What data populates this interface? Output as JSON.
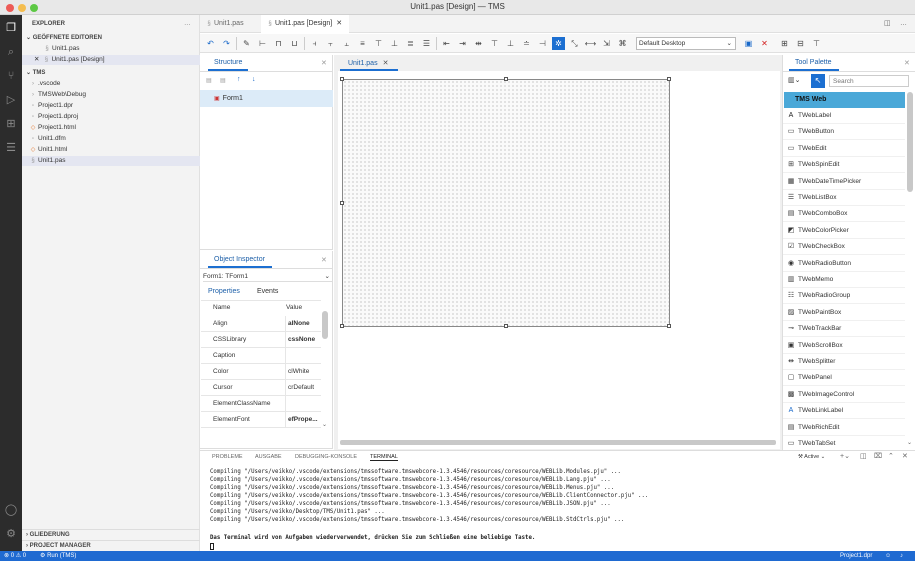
{
  "window": {
    "title": "Unit1.pas [Design] — TMS"
  },
  "sidebar": {
    "header": "EXPLORER",
    "open_editors_label": "GEÖFFNETE EDITOREN",
    "open_editors": [
      "Unit1.pas",
      "Unit1.pas [Design]"
    ],
    "project_label": "TMS",
    "files": [
      ".vscode",
      "TMSWeb\\Debug",
      "Project1.dpr",
      "Project1.dproj",
      "Project1.html",
      "Unit1.dfm",
      "Unit1.html",
      "Unit1.pas"
    ],
    "outline_label": "GLIEDERUNG",
    "project_manager_label": "PROJECT MANAGER"
  },
  "editor_tabs": [
    "Unit1.pas",
    "Unit1.pas [Design]"
  ],
  "toolbar": {
    "device": "Default Desktop"
  },
  "structure": {
    "title": "Structure",
    "items": [
      "Form1"
    ]
  },
  "inspector": {
    "title": "Object Inspector",
    "selected": "Form1: TForm1",
    "tabs": [
      "Properties",
      "Events"
    ],
    "col_name": "Name",
    "col_value": "Value",
    "rows": [
      {
        "name": "Align",
        "value": "alNone"
      },
      {
        "name": "CSSLibrary",
        "value": "cssNone"
      },
      {
        "name": "Caption",
        "value": ""
      },
      {
        "name": "Color",
        "value": "clWhite"
      },
      {
        "name": "Cursor",
        "value": "crDefault"
      },
      {
        "name": "ElementClassName",
        "value": ""
      },
      {
        "name": "ElementFont",
        "value": "efPrope..."
      }
    ]
  },
  "design": {
    "tab": "Unit1.pas"
  },
  "palette": {
    "title": "Tool Palette",
    "search_placeholder": "Search",
    "category": "TMS Web",
    "items": [
      {
        "label": "TWebLabel",
        "icon": "A"
      },
      {
        "label": "TWebButton",
        "icon": "▭"
      },
      {
        "label": "TWebEdit",
        "icon": "▭"
      },
      {
        "label": "TWebSpinEdit",
        "icon": "⊞"
      },
      {
        "label": "TWebDateTimePicker",
        "icon": "▦"
      },
      {
        "label": "TWebListBox",
        "icon": "☰"
      },
      {
        "label": "TWebComboBox",
        "icon": "▤"
      },
      {
        "label": "TWebColorPicker",
        "icon": "◩"
      },
      {
        "label": "TWebCheckBox",
        "icon": "☑"
      },
      {
        "label": "TWebRadioButton",
        "icon": "◉"
      },
      {
        "label": "TWebMemo",
        "icon": "▥"
      },
      {
        "label": "TWebRadioGroup",
        "icon": "☷"
      },
      {
        "label": "TWebPaintBox",
        "icon": "▨"
      },
      {
        "label": "TWebTrackBar",
        "icon": "⊸"
      },
      {
        "label": "TWebScrollBox",
        "icon": "▣"
      },
      {
        "label": "TWebSplitter",
        "icon": "⇹"
      },
      {
        "label": "TWebPanel",
        "icon": "▢"
      },
      {
        "label": "TWebImageControl",
        "icon": "▩"
      },
      {
        "label": "TWebLinkLabel",
        "icon": "A"
      },
      {
        "label": "TWebRichEdit",
        "icon": "▤"
      },
      {
        "label": "TWebTabSet",
        "icon": "▭"
      }
    ]
  },
  "panel_tabs": [
    "PROBLEME",
    "AUSGABE",
    "DEBUGGING-KONSOLE",
    "TERMINAL"
  ],
  "terminal": {
    "active_label": "Active",
    "lines": [
      "Compiling \"/Users/veikko/.vscode/extensions/tmssoftware.tmswebcore-1.3.4546/resources/coresource/WEBLib.Modules.pju\" ...",
      "Compiling \"/Users/veikko/.vscode/extensions/tmssoftware.tmswebcore-1.3.4546/resources/coresource/WEBLib.Lang.pju\" ...",
      "Compiling \"/Users/veikko/.vscode/extensions/tmssoftware.tmswebcore-1.3.4546/resources/coresource/WEBLib.Menus.pju\" ...",
      "Compiling \"/Users/veikko/.vscode/extensions/tmssoftware.tmswebcore-1.3.4546/resources/coresource/WEBLib.ClientConnector.pju\" ...",
      "Compiling \"/Users/veikko/.vscode/extensions/tmssoftware.tmswebcore-1.3.4546/resources/coresource/WEBLib.JSON.pju\" ...",
      "Compiling \"/Users/veikko/Desktop/TMS/Unit1.pas\" ...",
      "Compiling \"/Users/veikko/.vscode/extensions/tmssoftware.tmswebcore-1.3.4546/resources/coresource/WEBLib.StdCtrls.pju\" ..."
    ],
    "message": "Das Terminal wird von Aufgaben wiederverwendet, drücken Sie zum Schließen eine beliebige Taste."
  },
  "status": {
    "problems": "⊗ 0  ⚠ 0",
    "run": "Run (TMS)",
    "project": "Project1.dpr"
  }
}
